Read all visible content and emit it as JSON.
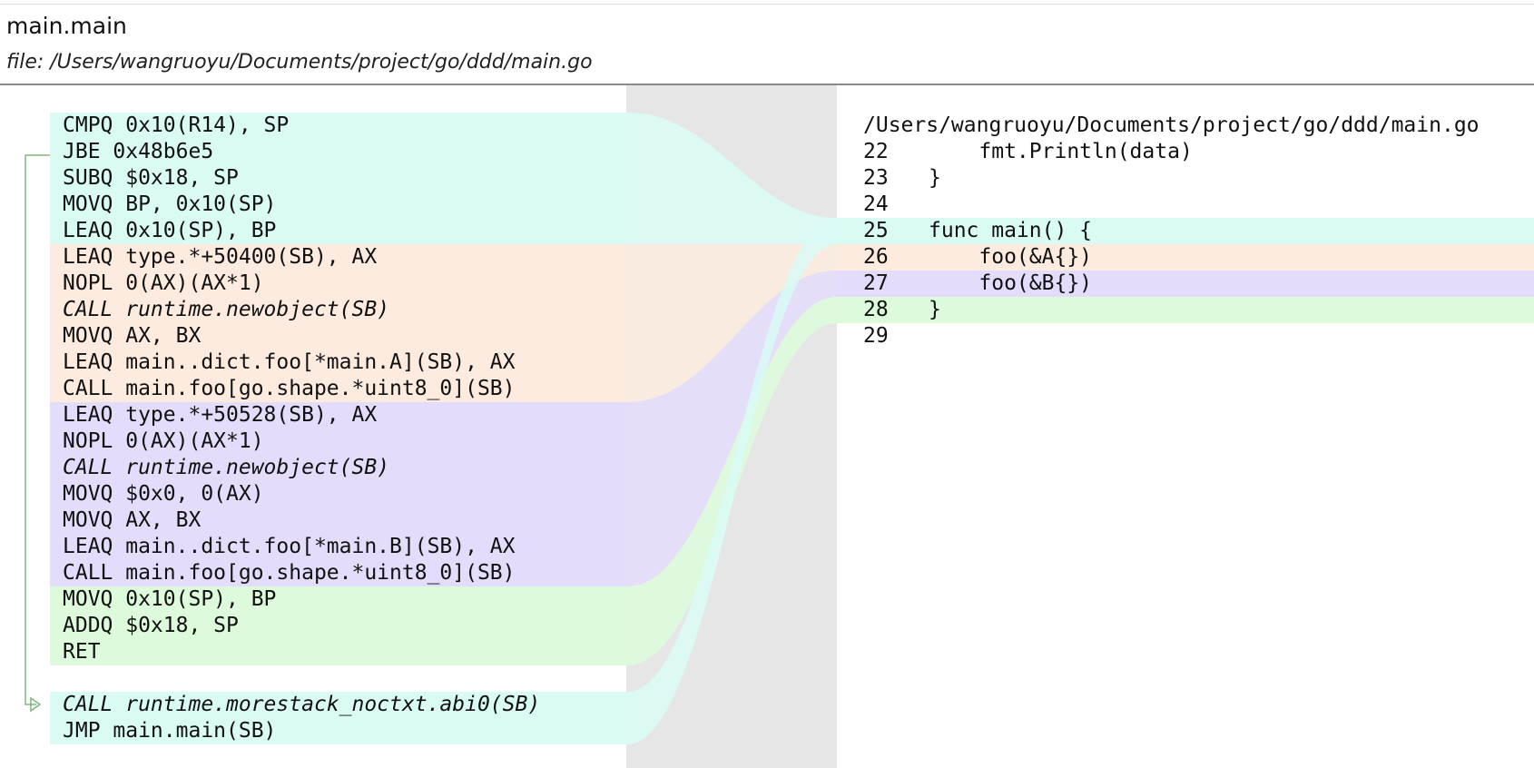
{
  "header": {
    "function_name": "main.main",
    "file_label": "file: /Users/wangruoyu/Documents/project/go/ddd/main.go"
  },
  "colors": {
    "line25": "#d9fbf4",
    "line26": "#fdebdf",
    "line27": "#e3dcfb",
    "line28": "#ddfbdc",
    "gutter": "#e6e6e6",
    "jump_line": "#7fb87f"
  },
  "asm": {
    "rows": [
      {
        "text": "CMPQ 0x10(R14), SP",
        "line": 25
      },
      {
        "text": "JBE 0x48b6e5",
        "line": 25
      },
      {
        "text": "SUBQ $0x18, SP",
        "line": 25
      },
      {
        "text": "MOVQ BP, 0x10(SP)",
        "line": 25
      },
      {
        "text": "LEAQ 0x10(SP), BP",
        "line": 25
      },
      {
        "text": "LEAQ type.*+50400(SB), AX",
        "line": 26
      },
      {
        "text": "NOPL 0(AX)(AX*1)",
        "line": 26
      },
      {
        "text": "CALL runtime.newobject(SB)",
        "line": 26,
        "italic": true
      },
      {
        "text": "MOVQ AX, BX",
        "line": 26
      },
      {
        "text": "LEAQ main..dict.foo[*main.A](SB), AX",
        "line": 26
      },
      {
        "text": "CALL main.foo[go.shape.*uint8_0](SB)",
        "line": 26
      },
      {
        "text": "LEAQ type.*+50528(SB), AX",
        "line": 27
      },
      {
        "text": "NOPL 0(AX)(AX*1)",
        "line": 27
      },
      {
        "text": "CALL runtime.newobject(SB)",
        "line": 27,
        "italic": true
      },
      {
        "text": "MOVQ $0x0, 0(AX)",
        "line": 27
      },
      {
        "text": "MOVQ AX, BX",
        "line": 27
      },
      {
        "text": "LEAQ main..dict.foo[*main.B](SB), AX",
        "line": 27
      },
      {
        "text": "CALL main.foo[go.shape.*uint8_0](SB)",
        "line": 27
      },
      {
        "text": "MOVQ 0x10(SP), BP",
        "line": 28
      },
      {
        "text": "ADDQ $0x18, SP",
        "line": 28
      },
      {
        "text": "RET",
        "line": 28
      },
      {
        "text": "",
        "line": null
      },
      {
        "text": "CALL runtime.morestack_noctxt.abi0(SB)",
        "line": 25,
        "italic": true
      },
      {
        "text": "JMP main.main(SB)",
        "line": 25
      }
    ]
  },
  "source": {
    "path": "/Users/wangruoyu/Documents/project/go/ddd/main.go",
    "lines": [
      {
        "num": "22",
        "code": "    fmt.Println(data)"
      },
      {
        "num": "23",
        "code": "}"
      },
      {
        "num": "24",
        "code": ""
      },
      {
        "num": "25",
        "code": "func main() {"
      },
      {
        "num": "26",
        "code": "    foo(&A{})"
      },
      {
        "num": "27",
        "code": "    foo(&B{})"
      },
      {
        "num": "28",
        "code": "}"
      },
      {
        "num": "29",
        "code": ""
      }
    ]
  }
}
